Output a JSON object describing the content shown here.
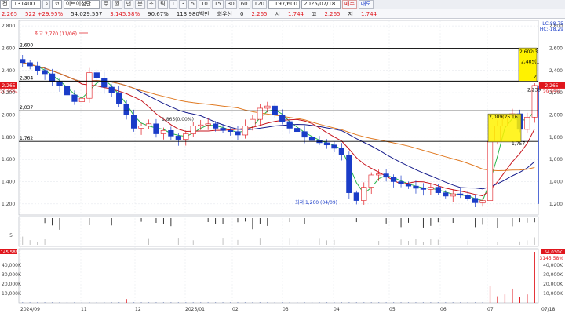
{
  "toolbar": {
    "period_value": "전",
    "code_value": "131400",
    "stock_name": "이브이첨단",
    "stock_type_label": "코",
    "period_buttons": [
      "주",
      "월",
      "년",
      "분",
      "초",
      "틱"
    ],
    "minute_buttons": [
      "1",
      "3",
      "5",
      "10",
      "15",
      "30",
      "60",
      "120"
    ],
    "count_value": "197/600",
    "date_value": "2025/07/18",
    "buy_button": "매수",
    "sell_button": "매도"
  },
  "info": {
    "price": "2,265",
    "change": "522 +29.95%",
    "volume": "54,029,557",
    "volume_ratio": "3,145.58%",
    "ratio2": "90.67%",
    "amount": "113,980백만",
    "preferred_label": "회우선",
    "zero_value": "0",
    "open_value": "2,265",
    "open_label": "시",
    "high_label": "고",
    "low_label": "저",
    "open_price": "1,744",
    "high_price": "2,265",
    "low_price": "1,744"
  },
  "colors": {
    "up": "#e0161d",
    "down": "#1a3cc8",
    "ma5": "#26b54a",
    "ma20": "#c7141d",
    "ma60": "#161c8c",
    "ma120": "#e07a23",
    "hline": "#000000",
    "box": "#fff200"
  },
  "chart_data": [
    {
      "type": "candlestick",
      "title": "",
      "ylim": [
        1100,
        2850
      ],
      "y_ticks": [
        "2,800",
        "2,600",
        "2,400",
        "2,200",
        "2,000",
        "1,800",
        "1,600",
        "1,400",
        "1,200"
      ],
      "x_ticks": [
        "2024/09",
        "11",
        "12",
        "2025/01",
        "02",
        "03",
        "04",
        "05",
        "06",
        "07",
        "07/18"
      ],
      "horizontal_lines": [
        {
          "value": 2600,
          "label": "2,600"
        },
        {
          "value": 2304,
          "label": "2,304"
        },
        {
          "value": 2037,
          "label": "2,037"
        },
        {
          "value": 1762,
          "label": "1,762"
        }
      ],
      "annotations": {
        "high": "최고 2,770 (11/06)",
        "low": "최저 1,200 (04/09)",
        "mid_label": "1,865(0.00%)",
        "box1_top": "2,602(3",
        "box1_mid": "2,485(1",
        "box1_bottom": "2,239",
        "box1_small": "2",
        "box2_top": "2,009(25.16",
        "box2_bottom": "1,757",
        "right_top1": "LC:88.75",
        "right_top2": "HC:-18.29",
        "right_price": "2,265",
        "right_pct": "29.95%",
        "left_price": "2,265",
        "left_pct": "29.95%"
      },
      "series_close_estimate": [
        2470,
        2440,
        2400,
        2370,
        2300,
        2260,
        2180,
        2120,
        2150,
        2380,
        2330,
        2250,
        2200,
        2100,
        2000,
        1880,
        1900,
        1920,
        1830,
        1860,
        1810,
        1780,
        1830,
        1900,
        1910,
        1920,
        1880,
        1860,
        1850,
        1820,
        1900,
        1960,
        2060,
        2080,
        2000,
        1940,
        1880,
        1850,
        1800,
        1770,
        1750,
        1730,
        1700,
        1640,
        1300,
        1230,
        1350,
        1460,
        1470,
        1440,
        1400,
        1380,
        1360,
        1340,
        1330,
        1350,
        1300,
        1270,
        1290,
        1280,
        1250,
        1210,
        1230,
        1760,
        1900,
        1990,
        2010,
        1870,
        1980,
        2265
      ]
    },
    {
      "type": "bar",
      "title": "",
      "y_ticks": [
        "5"
      ],
      "description": "signal indicator panel"
    },
    {
      "type": "bar",
      "title": "",
      "y_ticks": [
        "40,000K",
        "30,000K",
        "20,000K",
        "10,000K"
      ],
      "left_label": "3145.58%",
      "right_label": "54,030K",
      "right_pct": "3145.58%",
      "series": [
        {
          "name": "",
          "values": [
            150,
            120,
            80,
            300,
            200,
            180,
            100,
            90,
            70,
            60,
            90,
            100,
            120,
            110,
            4000,
            800,
            300,
            200,
            150,
            120,
            100,
            90,
            80,
            70,
            100,
            150,
            200,
            250,
            180,
            130,
            120,
            100,
            90,
            80,
            60,
            70,
            80,
            90,
            110,
            130,
            170,
            200,
            160,
            140,
            130,
            110,
            100,
            90,
            80,
            70,
            60,
            60,
            70,
            80,
            90,
            100,
            110,
            120,
            130,
            150,
            200,
            400,
            700,
            18000,
            7000,
            9000,
            15000,
            6000,
            9000,
            54030
          ]
        }
      ]
    }
  ]
}
